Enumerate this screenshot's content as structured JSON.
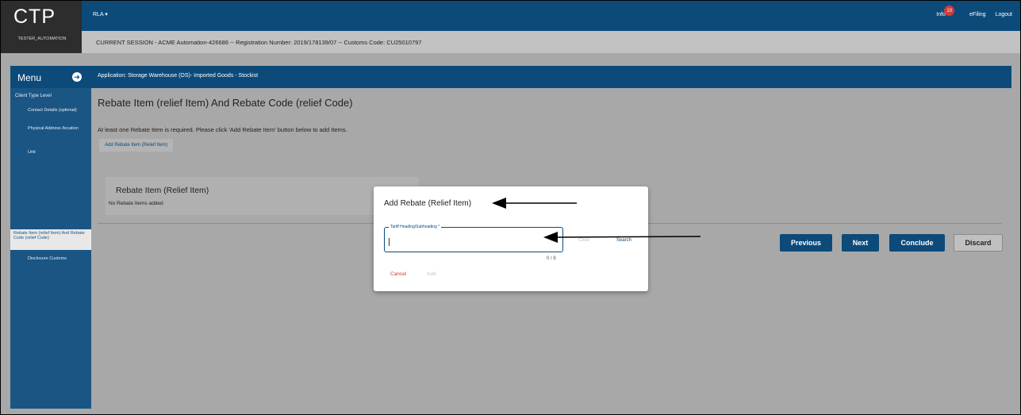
{
  "header": {
    "logo": "CTP",
    "user": "TESTER_AUTOMATION",
    "app_switch": "RLA",
    "info_label": "Info",
    "info_count": "10",
    "efiling": "eFiling",
    "logout": "Logout"
  },
  "session": {
    "text": "CURRENT SESSION - ACME Automation-426686 -- Registration Number: 2019/178139/07 -- Customs Code: CU25010797"
  },
  "sidebar": {
    "menu_label": "Menu",
    "section_title": "Client Type Level",
    "items": [
      {
        "label": "Contact Details (optional)"
      },
      {
        "label": "Physical Address /location"
      },
      {
        "label": "Unit"
      },
      {
        "label": "Rebate Item (relief Item) And Rebate Code (relief Code)"
      },
      {
        "label": "Disclosure Customs"
      }
    ]
  },
  "application": {
    "header": "Application: Storage Warehouse (OS)- Imported Goods - Stockist"
  },
  "main": {
    "title": "Rebate Item (relief Item) And Rebate Code (relief Code)",
    "instruction": "At least one Rebate Item is required. Please click 'Add Rebate Item' button below to add Items.",
    "add_button": "Add Rebate Item (Relief Item)",
    "card_title": "Rebate Item (Relief Item)",
    "card_empty": "No Rebate Items added",
    "buttons": {
      "previous": "Previous",
      "next": "Next",
      "conclude": "Conclude",
      "discard": "Discard"
    }
  },
  "modal": {
    "title": "Add Rebate (Relief Item)",
    "field_label": "Tariff Heading/Subheading *",
    "field_value": "",
    "clear": "Clear",
    "search": "Search",
    "counter": "0 / 8",
    "cancel": "Cancel",
    "add": "Add"
  },
  "colors": {
    "primary": "#0c4a7a",
    "danger": "#c93a3a",
    "overlay_gray": "#a8a8a8"
  }
}
